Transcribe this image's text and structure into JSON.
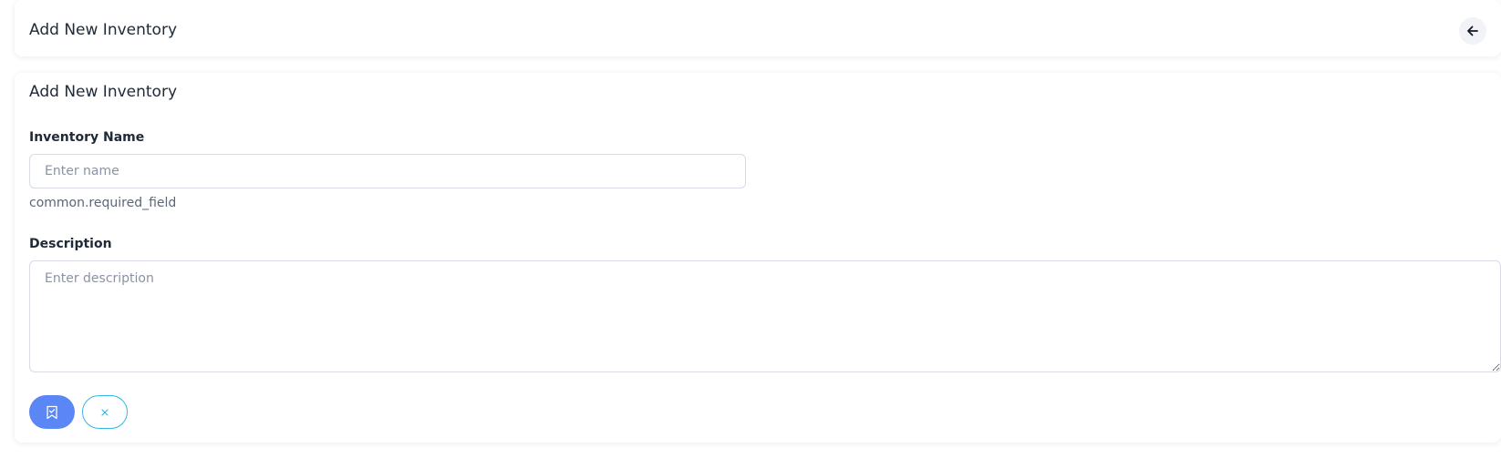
{
  "header": {
    "title": "Add New Inventory",
    "back_icon": "arrow-left-icon"
  },
  "form": {
    "title": "Add New Inventory",
    "name_field": {
      "label": "Inventory Name",
      "placeholder": "Enter name",
      "value": "",
      "hint": "common.required_field"
    },
    "description_field": {
      "label": "Description",
      "placeholder": "Enter description",
      "value": ""
    },
    "actions": {
      "save_icon": "bookmark-check-icon",
      "cancel_icon": "close-icon"
    }
  },
  "colors": {
    "primary": "#5b86f5",
    "cancel_border": "#35b6e8",
    "text": "#1f2937",
    "muted": "#8a93a3"
  }
}
